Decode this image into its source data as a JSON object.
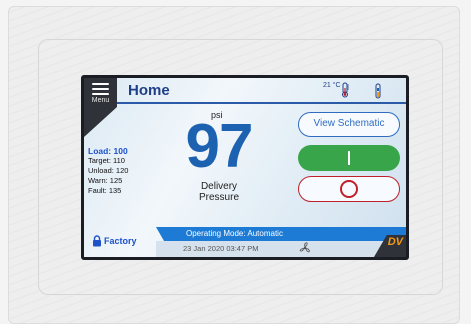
{
  "header": {
    "menu_label": "Menu",
    "title": "Home",
    "temperature": "21 °C"
  },
  "icons": {
    "menu": "hamburger-icon",
    "thermometer": "thermometer-icon",
    "level": "level-indicator-icon",
    "lock": "lock-icon",
    "fan": "fan-icon"
  },
  "pressure": {
    "unit": "psi",
    "value": "97",
    "caption_line1": "Delivery",
    "caption_line2": "Pressure"
  },
  "settings": {
    "load": "Load: 100",
    "target": "Target: 110",
    "unload": "Unload: 120",
    "warn": "Warn: 125",
    "fault": "Fault: 135"
  },
  "buttons": {
    "view_schematic": "View Schematic"
  },
  "status": {
    "operating_mode": "Operating Mode: Automatic",
    "datetime": "23 Jan 2020  03:47 PM",
    "access_level": "Factory"
  },
  "brand": {
    "logo_text": "DV"
  },
  "colors": {
    "accent_blue": "#1d62b0",
    "start_green": "#38a54a",
    "stop_red": "#c0202a",
    "brand_orange": "#f39a1a"
  }
}
